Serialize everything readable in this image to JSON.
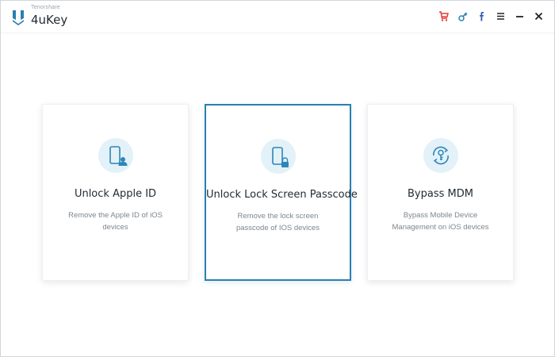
{
  "app": {
    "vendor": "Tenorshare",
    "name": "4uKey"
  },
  "titlebar": {
    "icons": [
      "cart-icon",
      "key-icon",
      "facebook-icon",
      "menu-icon",
      "minimize-icon",
      "close-icon"
    ],
    "accent_color": "#e43b3b"
  },
  "cards": [
    {
      "title": "Unlock Apple ID",
      "description": "Remove the Apple ID of iOS devices",
      "icon": "phone-user-icon",
      "selected": false
    },
    {
      "title": "Unlock Lock Screen Passcode",
      "description": "Remove the lock screen passcode of IOS devices",
      "icon": "phone-lock-icon",
      "selected": true
    },
    {
      "title": "Bypass MDM",
      "description": "Bypass Mobile Device Management on iOS devices",
      "icon": "mdm-key-icon",
      "selected": false
    }
  ],
  "colors": {
    "selected_border": "#2b7fb0",
    "icon_blue": "#2c86b8",
    "icon_bg": "#e3f1f8"
  }
}
